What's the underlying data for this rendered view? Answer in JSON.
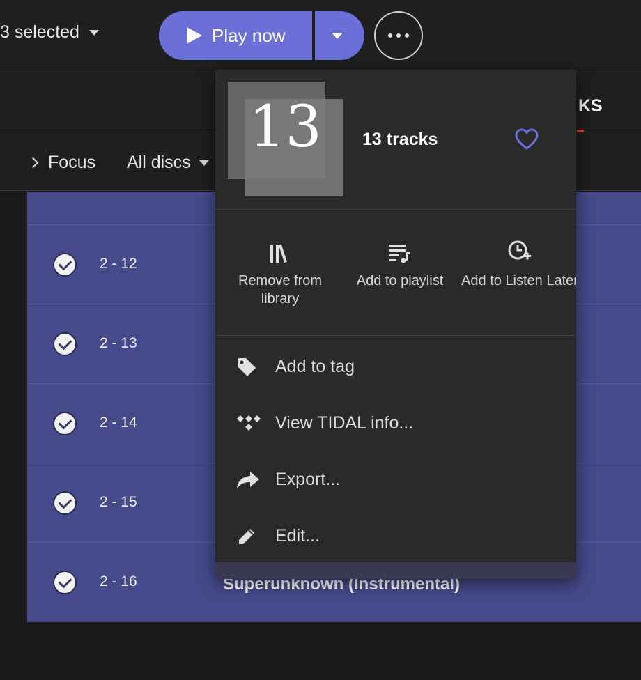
{
  "toolbar": {
    "selection_label": "3 selected",
    "play_label": "Play now"
  },
  "tabs": {
    "active_tab_partial": "KS"
  },
  "filters": {
    "focus_label": "Focus",
    "discs_label": "All discs"
  },
  "tracks": [
    {
      "number": "2 - 12",
      "title": ""
    },
    {
      "number": "2 - 13",
      "title": ""
    },
    {
      "number": "2 - 14",
      "title": ""
    },
    {
      "number": "2 - 15",
      "title": ""
    },
    {
      "number": "2 - 16",
      "title": "Superunknown (Instrumental)"
    }
  ],
  "popup": {
    "art_number": "13",
    "title": "13 tracks",
    "actions": {
      "remove_library": "Remove from library",
      "add_playlist": "Add to playlist",
      "listen_later": "Add to Listen Later"
    },
    "menu": {
      "add_tag": "Add to tag",
      "tidal_info": "View TIDAL info...",
      "export": "Export...",
      "edit": "Edit..."
    }
  },
  "colors": {
    "accent": "#6b70d8",
    "selection_bg": "#464a8a",
    "active_tab_underline": "#e0483e"
  }
}
